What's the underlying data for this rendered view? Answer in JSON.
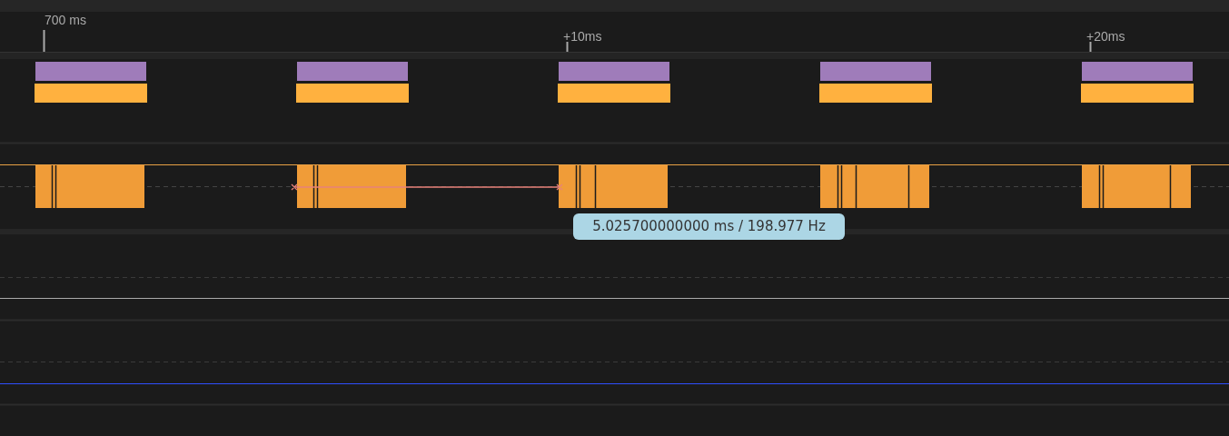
{
  "ruler": {
    "ticks": [
      {
        "label": "700 ms"
      },
      {
        "label": "+10ms"
      },
      {
        "label": "+20ms"
      }
    ]
  },
  "measurement": {
    "label": "5.025700000000 ms / 198.977 Hz"
  }
}
